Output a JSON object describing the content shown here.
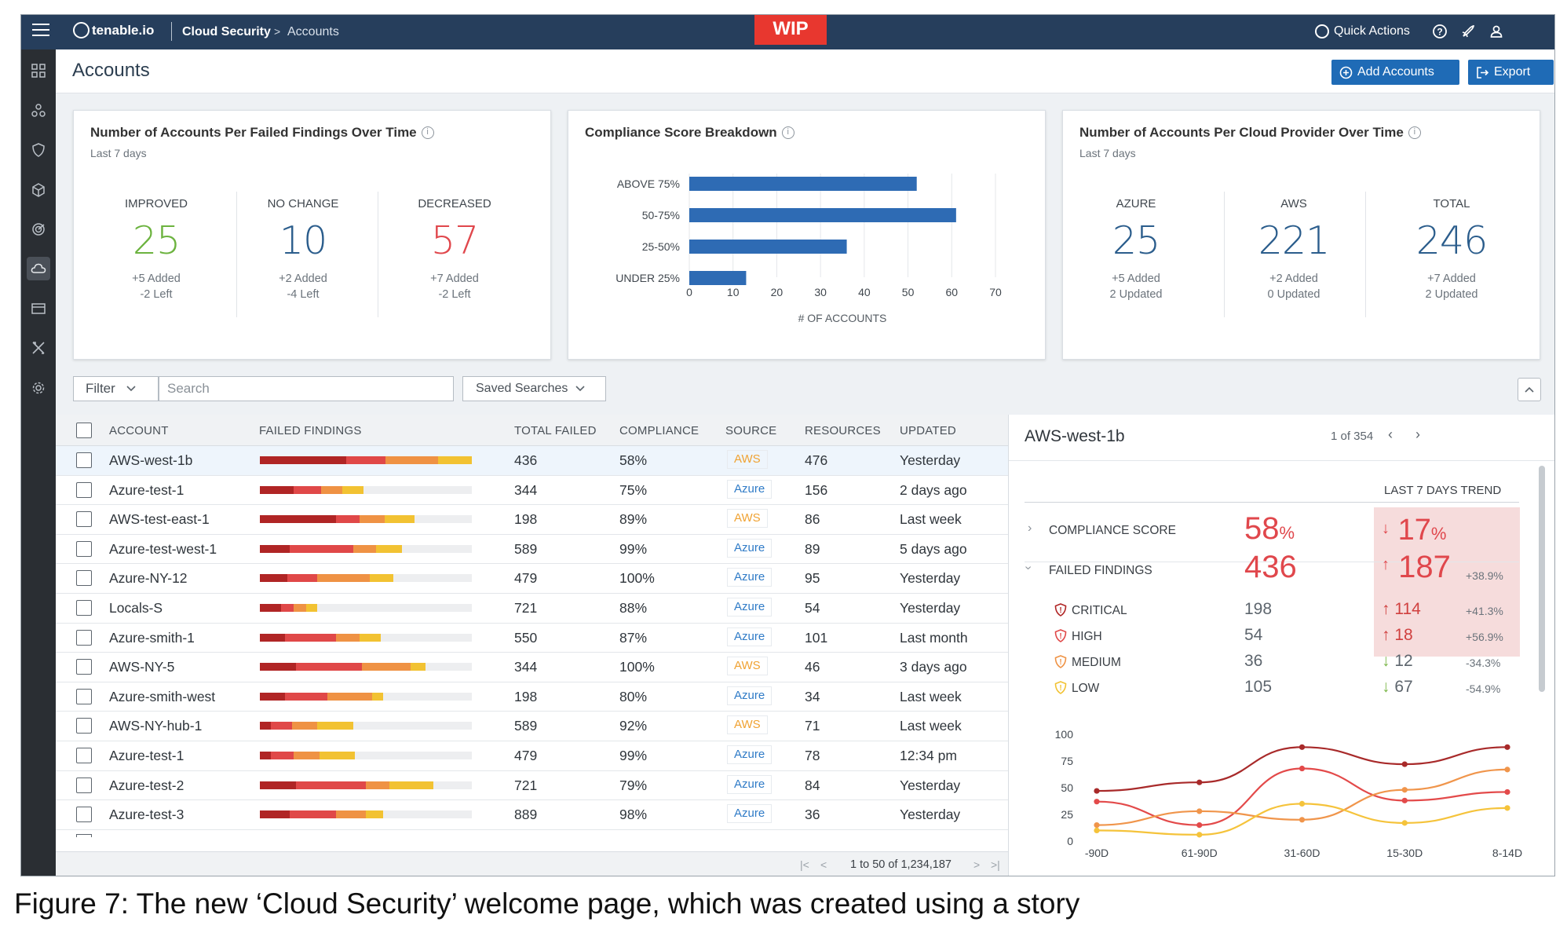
{
  "topbar": {
    "logo": "tenable.io",
    "crumb_app": "Cloud Security",
    "crumb_page": "Accounts",
    "wip": "WIP",
    "quick_actions": "Quick Actions"
  },
  "page": {
    "title": "Accounts",
    "add_accounts": "Add Accounts",
    "export": "Export"
  },
  "card_findings": {
    "title": "Number of Accounts Per Failed Findings Over Time",
    "subtitle": "Last 7 days",
    "stats": [
      {
        "label": "IMPROVED",
        "value": "25",
        "line1": "+5 Added",
        "line2": "-2 Left",
        "color": "#6cb33f"
      },
      {
        "label": "NO CHANGE",
        "value": "10",
        "line1": "+2 Added",
        "line2": "-4 Left",
        "color": "#2b5d8c"
      },
      {
        "label": "DECREASED",
        "value": "57",
        "line1": "+7 Added",
        "line2": "-2 Left",
        "color": "#e0474c"
      }
    ]
  },
  "card_compliance": {
    "title": "Compliance Score Breakdown"
  },
  "card_provider": {
    "title": "Number of Accounts Per Cloud Provider Over Time",
    "subtitle": "Last 7 days",
    "stats": [
      {
        "label": "AZURE",
        "value": "25",
        "line1": "+5 Added",
        "line2": "2 Updated",
        "color": "#2b5d8c"
      },
      {
        "label": "AWS",
        "value": "221",
        "line1": "+2 Added",
        "line2": "0 Updated",
        "color": "#2b5d8c"
      },
      {
        "label": "TOTAL",
        "value": "246",
        "line1": "+7 Added",
        "line2": "2 Updated",
        "color": "#2b5d8c"
      }
    ]
  },
  "chart_data": [
    {
      "type": "bar",
      "orientation": "horizontal",
      "categories": [
        "ABOVE 75%",
        "50-75%",
        "25-50%",
        "UNDER 25%"
      ],
      "values": [
        52,
        61,
        36,
        13
      ],
      "xlabel": "# OF ACCOUNTS",
      "xlim": [
        0,
        70
      ],
      "xticks": [
        0,
        10,
        20,
        30,
        40,
        50,
        60,
        70
      ],
      "color": "#2e6bb4",
      "grid": true
    },
    {
      "type": "line",
      "x": [
        "-90D",
        "61-90D",
        "31-60D",
        "15-30D",
        "8-14D"
      ],
      "ylim": [
        0,
        100
      ],
      "yticks": [
        0,
        25,
        50,
        75,
        100
      ],
      "series": [
        {
          "color": "#a82a2a",
          "values": [
            [
              0,
              47
            ],
            [
              1,
              55
            ],
            [
              2,
              88
            ],
            [
              3,
              72
            ],
            [
              4,
              88
            ]
          ]
        },
        {
          "color": "#e34a4a",
          "values": [
            [
              0,
              37
            ],
            [
              1,
              15
            ],
            [
              2,
              68
            ],
            [
              3,
              38
            ],
            [
              4,
              46
            ]
          ]
        },
        {
          "color": "#f0954b",
          "values": [
            [
              0,
              15
            ],
            [
              1,
              28
            ],
            [
              2,
              20
            ],
            [
              3,
              48
            ],
            [
              4,
              67
            ]
          ]
        },
        {
          "color": "#f5c33b",
          "values": [
            [
              0,
              10
            ],
            [
              1,
              6
            ],
            [
              2,
              35
            ],
            [
              3,
              17
            ],
            [
              4,
              31
            ]
          ]
        }
      ],
      "grid": false
    }
  ],
  "filters": {
    "filter_label": "Filter",
    "search_placeholder": "Search",
    "saved_searches": "Saved Searches"
  },
  "table": {
    "headers": [
      "ACCOUNT",
      "FAILED FINDINGS",
      "TOTAL FAILED",
      "COMPLIANCE",
      "SOURCE",
      "RESOURCES",
      "UPDATED"
    ],
    "rows": [
      {
        "account": "AWS-west-1b",
        "bar": [
          41,
          19,
          25,
          16
        ],
        "total": "436",
        "compliance": "58%",
        "source": "AWS",
        "resources": "476",
        "updated": "Yesterday",
        "selected": true
      },
      {
        "account": "Azure-test-1",
        "bar": [
          16,
          13,
          10,
          10
        ],
        "total": "344",
        "compliance": "75%",
        "source": "Azure",
        "resources": "156",
        "updated": "2 days ago"
      },
      {
        "account": "AWS-test-east-1",
        "bar": [
          36,
          11,
          12,
          14
        ],
        "total": "198",
        "compliance": "89%",
        "source": "AWS",
        "resources": "86",
        "updated": "Last week"
      },
      {
        "account": "Azure-test-west-1",
        "bar": [
          14,
          30,
          11,
          12
        ],
        "total": "589",
        "compliance": "99%",
        "source": "Azure",
        "resources": "89",
        "updated": "5 days ago"
      },
      {
        "account": "Azure-NY-12",
        "bar": [
          13,
          14,
          25,
          11
        ],
        "total": "479",
        "compliance": "100%",
        "source": "Azure",
        "resources": "95",
        "updated": "Yesterday"
      },
      {
        "account": "Locals-S",
        "bar": [
          10,
          6,
          6,
          5
        ],
        "total": "721",
        "compliance": "88%",
        "source": "Azure",
        "resources": "54",
        "updated": "Yesterday"
      },
      {
        "account": "Azure-smith-1",
        "bar": [
          12,
          24,
          11,
          10
        ],
        "total": "550",
        "compliance": "87%",
        "source": "Azure",
        "resources": "101",
        "updated": "Last month",
        "warn": true
      },
      {
        "account": "AWS-NY-5",
        "bar": [
          17,
          31,
          23,
          7
        ],
        "total": "344",
        "compliance": "100%",
        "source": "AWS",
        "resources": "46",
        "updated": "3 days ago"
      },
      {
        "account": "Azure-smith-west",
        "bar": [
          12,
          20,
          21,
          5
        ],
        "total": "198",
        "compliance": "80%",
        "source": "Azure",
        "resources": "34",
        "updated": "Last week"
      },
      {
        "account": "AWS-NY-hub-1",
        "bar": [
          5,
          10,
          12,
          17
        ],
        "total": "589",
        "compliance": "92%",
        "source": "AWS",
        "resources": "71",
        "updated": "Last week"
      },
      {
        "account": "Azure-test-1",
        "bar": [
          5,
          11,
          12,
          17
        ],
        "total": "479",
        "compliance": "99%",
        "source": "Azure",
        "resources": "78",
        "updated": "12:34 pm"
      },
      {
        "account": "Azure-test-2",
        "bar": [
          17,
          33,
          11,
          21
        ],
        "total": "721",
        "compliance": "79%",
        "source": "Azure",
        "resources": "84",
        "updated": "Yesterday"
      },
      {
        "account": "Azure-test-3",
        "bar": [
          14,
          22,
          14,
          8
        ],
        "total": "889",
        "compliance": "98%",
        "source": "Azure",
        "resources": "36",
        "updated": "Yesterday"
      }
    ],
    "bar_colors": [
      "#b02525",
      "#e04848",
      "#ef9244",
      "#f2c232"
    ],
    "pagination": "1 to 50 of 1,234,187"
  },
  "detail": {
    "title": "AWS-west-1b",
    "nav": "1 of 354",
    "trend_header": "LAST 7 DAYS TREND",
    "compliance_label": "COMPLIANCE SCORE",
    "compliance_value": "58",
    "compliance_unit": "%",
    "compliance_trend": "17",
    "compliance_trend_unit": "%",
    "findings_label": "FAILED FINDINGS",
    "findings_value": "436",
    "findings_trend": "187",
    "findings_pct": "+38.9%",
    "severities": [
      {
        "label": "CRITICAL",
        "value": "198",
        "trend": "114",
        "pct": "+41.3%",
        "dir": "up",
        "color": "#b02525"
      },
      {
        "label": "HIGH",
        "value": "54",
        "trend": "18",
        "pct": "+56.9%",
        "dir": "up",
        "color": "#e04848"
      },
      {
        "label": "MEDIUM",
        "value": "36",
        "trend": "12",
        "pct": "-34.3%",
        "dir": "down",
        "color": "#ef9244"
      },
      {
        "label": "LOW",
        "value": "105",
        "trend": "67",
        "pct": "-54.9%",
        "dir": "down",
        "color": "#f2c232"
      }
    ]
  },
  "caption": "Figure 7: The new ‘Cloud Security’  welcome page, which was created using a story"
}
